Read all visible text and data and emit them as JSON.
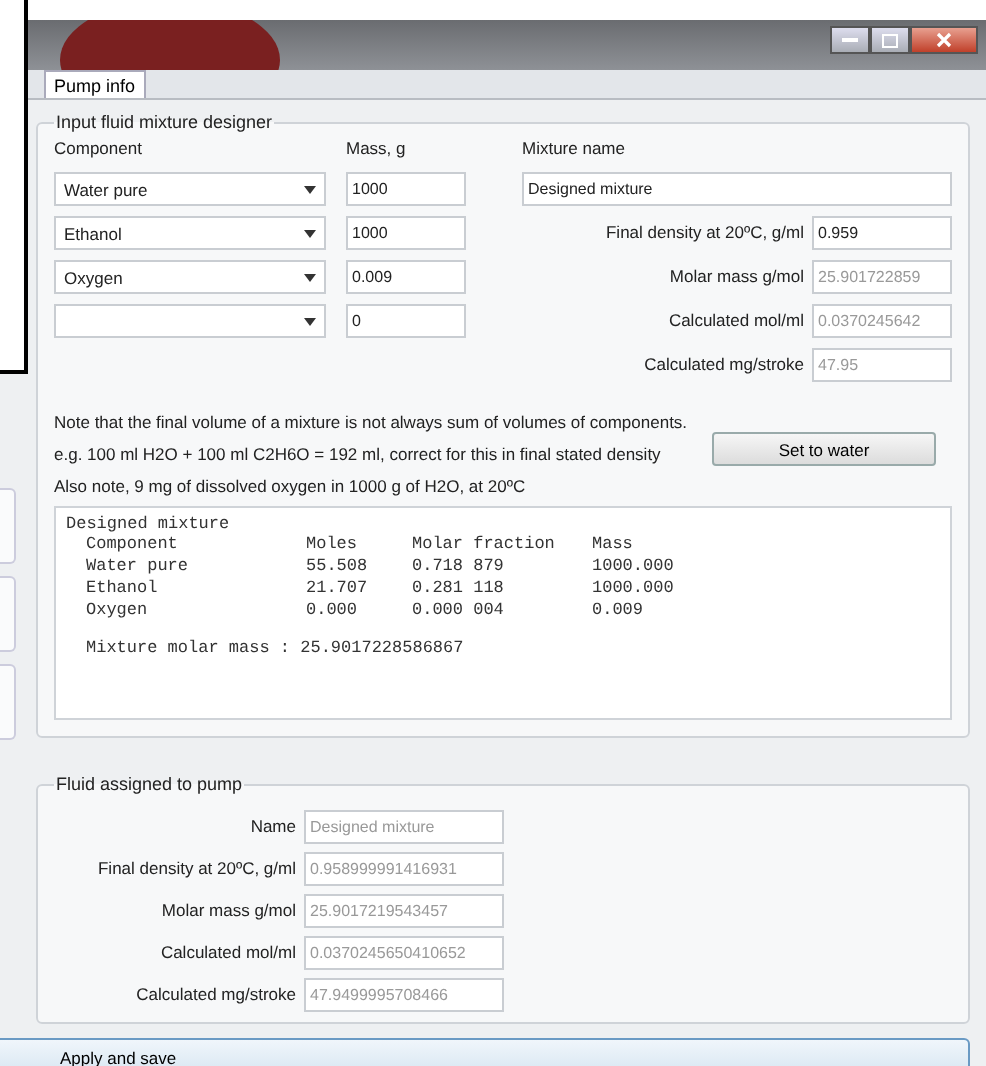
{
  "tabs": [
    {
      "label": "Pump info",
      "selected": true
    }
  ],
  "designer": {
    "title": "Input fluid mixture designer",
    "component_header": "Component",
    "mass_header": "Mass, g",
    "mixture_name_label": "Mixture name",
    "mixture_name": "Designed mixture",
    "components": [
      {
        "component": "Water pure",
        "mass": "1000"
      },
      {
        "component": "Ethanol",
        "mass": "1000"
      },
      {
        "component": "Oxygen",
        "mass": "0.009"
      },
      {
        "mass": "0"
      }
    ],
    "properties": [
      {
        "label": "Final density at 20ºC, g/ml",
        "value": "0.959",
        "disabled": false
      },
      {
        "label": "Molar mass g/mol",
        "value": "25.901722859",
        "disabled": true
      },
      {
        "label": "Calculated mol/ml",
        "value": "0.0370245642",
        "disabled": true
      },
      {
        "label": "Calculated mg/stroke",
        "value": "47.95",
        "disabled": true
      }
    ],
    "notes": [
      "Note that the final volume of a mixture is not always sum of volumes of components.",
      "e.g. 100 ml H2O + 100 ml C2H6O = 192 ml, correct for this in final stated density",
      "Also note, 9 mg of dissolved oxygen in 1000 g of H2O, at 20ºC"
    ],
    "set_button": "Set to water",
    "output": {
      "title": "Designed mixture",
      "columns": [
        "Component",
        "Moles",
        "Molar fraction",
        "Mass"
      ],
      "rows": [
        [
          "Water pure",
          "55.508",
          "0.718 879",
          "1000.000"
        ],
        [
          "Ethanol",
          "21.707",
          "0.281 118",
          "1000.000"
        ],
        [
          "Oxygen",
          "0.000",
          "0.000 004",
          "0.009"
        ]
      ],
      "summary": "Mixture molar mass : 25.9017228586867"
    }
  },
  "fluid": {
    "title": "Fluid assigned to pump",
    "fields": [
      {
        "label": "Name",
        "value": "Designed mixture",
        "disabled": true
      },
      {
        "label": "Final density at 20ºC, g/ml",
        "value": "0.958999991416931",
        "disabled": true
      },
      {
        "label": "Molar mass g/mol",
        "value": "25.9017219543457",
        "disabled": true
      },
      {
        "label": "Calculated mol/ml",
        "value": "0.0370245650410652",
        "disabled": true
      },
      {
        "label": "Calculated mg/stroke",
        "value": "47.9499995708466",
        "disabled": true
      }
    ]
  },
  "apply_button": "Apply and save"
}
